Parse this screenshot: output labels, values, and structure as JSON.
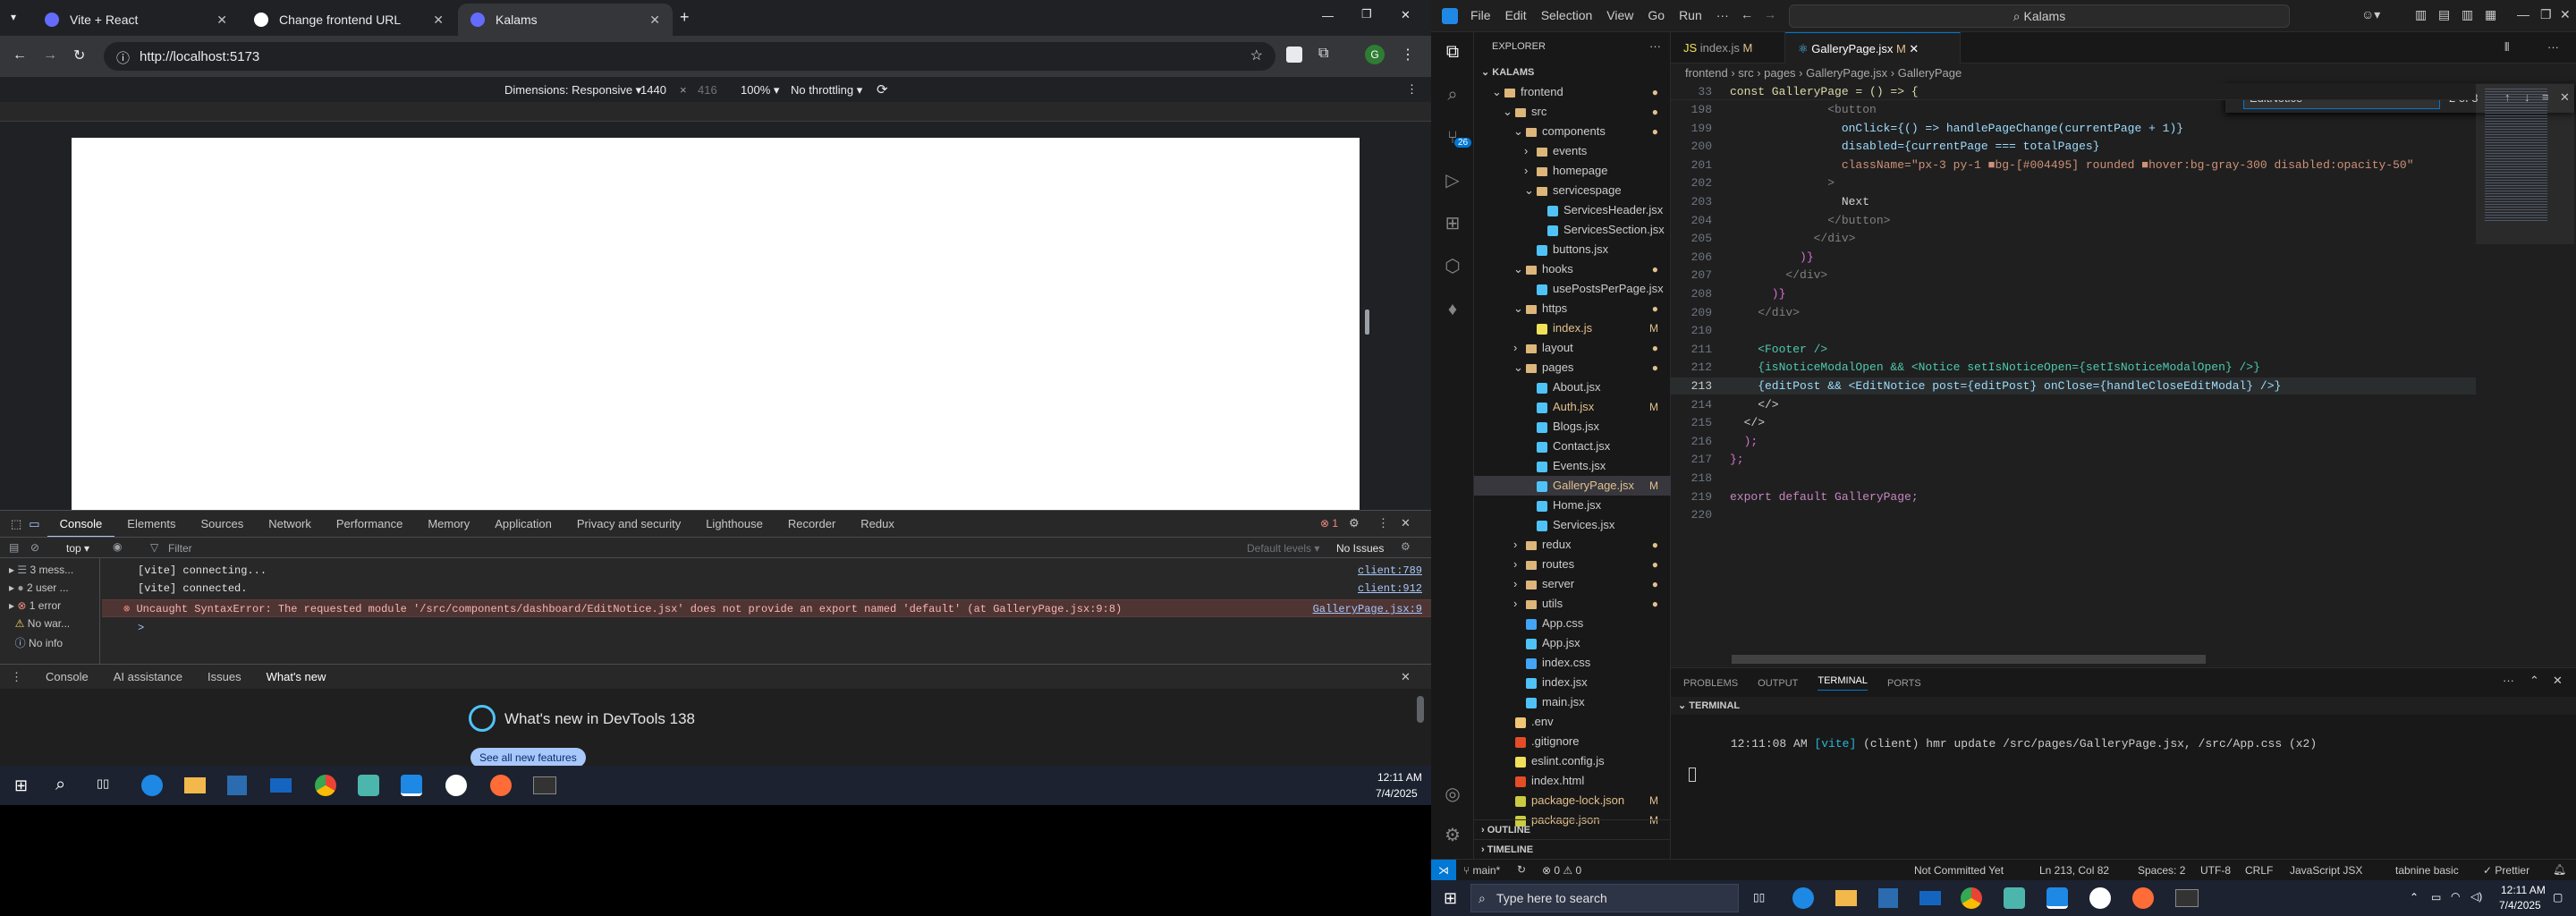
{
  "browser": {
    "tabs": [
      {
        "title": "Vite + React",
        "fav_color": "#646cff"
      },
      {
        "title": "Change frontend URL",
        "fav_color": "#ffffff"
      },
      {
        "title": "Kalams",
        "fav_color": "#646cff"
      }
    ],
    "url": "http://localhost:5173",
    "device_toolbar": {
      "dimensions": "Dimensions: Responsive ▾",
      "width": "1440",
      "times": "×",
      "height": "416",
      "zoom": "100% ▾",
      "throttle": "No throttling ▾"
    }
  },
  "devtools": {
    "tabs": [
      "Console",
      "Elements",
      "Sources",
      "Network",
      "Performance",
      "Memory",
      "Application",
      "Privacy and security",
      "Lighthouse",
      "Recorder",
      "Redux"
    ],
    "error_count": "1",
    "context": "top ▾",
    "filter_placeholder": "Filter",
    "levels": "Default levels ▾",
    "issues": "No Issues",
    "sidebar": [
      {
        "label": "3 mess..."
      },
      {
        "label": "2 user ..."
      },
      {
        "label": "1 error"
      },
      {
        "label": "No war..."
      },
      {
        "label": "No info"
      }
    ],
    "lines": [
      {
        "text": "[vite] connecting...",
        "link": "client:789"
      },
      {
        "text": "[vite] connected.",
        "link": "client:912"
      },
      {
        "text": "Uncaught SyntaxError: The requested module '/src/components/dashboard/EditNotice.jsx' does not provide an export named 'default' (at GalleryPage.jsx:9:8)",
        "link": "GalleryPage.jsx:9"
      }
    ],
    "prompt": ">",
    "drawer_tabs": [
      "Console",
      "AI assistance",
      "Issues",
      "What's new"
    ],
    "whats_new_title": "What's new in DevTools 138",
    "whats_new_button": "See all new features"
  },
  "left_taskbar": {
    "time": "12:11 AM",
    "date": "7/4/2025"
  },
  "vscode": {
    "menu": [
      "File",
      "Edit",
      "Selection",
      "View",
      "Go",
      "Run",
      "···"
    ],
    "search": "Kalams",
    "explorer_title": "EXPLORER",
    "root": "KALAMS",
    "tree": [
      {
        "label": "frontend",
        "indent": 1,
        "type": "folder",
        "mark": "",
        "open": true
      },
      {
        "label": "src",
        "indent": 2,
        "type": "folder",
        "mark": "",
        "open": true
      },
      {
        "label": "components",
        "indent": 3,
        "type": "folder",
        "mark": "",
        "open": true
      },
      {
        "label": "events",
        "indent": 4,
        "type": "folder",
        "mark": "",
        "open": false
      },
      {
        "label": "homepage",
        "indent": 4,
        "type": "folder",
        "mark": "",
        "open": false
      },
      {
        "label": "servicespage",
        "indent": 4,
        "type": "folder",
        "mark": "",
        "open": true
      },
      {
        "label": "ServicesHeader.jsx",
        "indent": 5,
        "type": "jsx",
        "mark": ""
      },
      {
        "label": "ServicesSection.jsx",
        "indent": 5,
        "type": "jsx",
        "mark": ""
      },
      {
        "label": "buttons.jsx",
        "indent": 4,
        "type": "jsx",
        "mark": ""
      },
      {
        "label": "hooks",
        "indent": 3,
        "type": "folder",
        "mark": "",
        "open": true
      },
      {
        "label": "usePostsPerPage.jsx",
        "indent": 4,
        "type": "jsx",
        "mark": ""
      },
      {
        "label": "https",
        "indent": 3,
        "type": "folder",
        "mark": "",
        "open": true
      },
      {
        "label": "index.js",
        "indent": 4,
        "type": "js",
        "mark": "M"
      },
      {
        "label": "layout",
        "indent": 3,
        "type": "folder",
        "mark": "",
        "open": false
      },
      {
        "label": "pages",
        "indent": 3,
        "type": "folder",
        "mark": "",
        "open": true
      },
      {
        "label": "About.jsx",
        "indent": 4,
        "type": "jsx",
        "mark": ""
      },
      {
        "label": "Auth.jsx",
        "indent": 4,
        "type": "jsx",
        "mark": "M"
      },
      {
        "label": "Blogs.jsx",
        "indent": 4,
        "type": "jsx",
        "mark": ""
      },
      {
        "label": "Contact.jsx",
        "indent": 4,
        "type": "jsx",
        "mark": ""
      },
      {
        "label": "Events.jsx",
        "indent": 4,
        "type": "jsx",
        "mark": ""
      },
      {
        "label": "GalleryPage.jsx",
        "indent": 4,
        "type": "jsx",
        "mark": "M",
        "selected": true
      },
      {
        "label": "Home.jsx",
        "indent": 4,
        "type": "jsx",
        "mark": ""
      },
      {
        "label": "Services.jsx",
        "indent": 4,
        "type": "jsx",
        "mark": ""
      },
      {
        "label": "redux",
        "indent": 3,
        "type": "folder",
        "mark": "",
        "open": false
      },
      {
        "label": "routes",
        "indent": 3,
        "type": "folder",
        "mark": "",
        "open": false
      },
      {
        "label": "server",
        "indent": 3,
        "type": "folder",
        "mark": "",
        "open": false
      },
      {
        "label": "utils",
        "indent": 3,
        "type": "folder",
        "mark": "",
        "open": false
      },
      {
        "label": "App.css",
        "indent": 3,
        "type": "css",
        "mark": ""
      },
      {
        "label": "App.jsx",
        "indent": 3,
        "type": "jsx",
        "mark": ""
      },
      {
        "label": "index.css",
        "indent": 3,
        "type": "css",
        "mark": ""
      },
      {
        "label": "index.jsx",
        "indent": 3,
        "type": "jsx",
        "mark": ""
      },
      {
        "label": "main.jsx",
        "indent": 3,
        "type": "jsx",
        "mark": ""
      },
      {
        "label": ".env",
        "indent": 2,
        "type": "env",
        "mark": ""
      },
      {
        "label": ".gitignore",
        "indent": 2,
        "type": "git",
        "mark": ""
      },
      {
        "label": "eslint.config.js",
        "indent": 2,
        "type": "js",
        "mark": ""
      },
      {
        "label": "index.html",
        "indent": 2,
        "type": "html",
        "mark": ""
      },
      {
        "label": "package-lock.json",
        "indent": 2,
        "type": "json",
        "mark": "M"
      },
      {
        "label": "package.json",
        "indent": 2,
        "type": "json",
        "mark": "M"
      }
    ],
    "outline": "OUTLINE",
    "timeline": "TIMELINE",
    "editor_tabs": [
      {
        "label": "index.js",
        "mark": "M"
      },
      {
        "label": "GalleryPage.jsx",
        "mark": "M"
      }
    ],
    "breadcrumb": "frontend  ›  src  ›  pages  ›  GalleryPage.jsx  ›  GalleryPage",
    "sticky": {
      "num": "33",
      "code": "const GalleryPage = () => {"
    },
    "find": {
      "value": "EditNotice",
      "count": "2 of 3"
    },
    "code": [
      {
        "num": "198",
        "code": "              <button"
      },
      {
        "num": "199",
        "code": "                onClick={() => handlePageChange(currentPage + 1)}"
      },
      {
        "num": "200",
        "code": "                disabled={currentPage === totalPages}"
      },
      {
        "num": "201",
        "code": "                className=\"px-3 py-1 ■bg-[#004495] rounded ■hover:bg-gray-300 disabled:opacity-50\""
      },
      {
        "num": "202",
        "code": "              >"
      },
      {
        "num": "203",
        "code": "                Next"
      },
      {
        "num": "204",
        "code": "              </button>"
      },
      {
        "num": "205",
        "code": "            </div>"
      },
      {
        "num": "206",
        "code": "          )}"
      },
      {
        "num": "207",
        "code": "        </div>"
      },
      {
        "num": "208",
        "code": "      )}"
      },
      {
        "num": "209",
        "code": "    </div>"
      },
      {
        "num": "210",
        "code": ""
      },
      {
        "num": "211",
        "code": "    <Footer />"
      },
      {
        "num": "212",
        "code": "    {isNoticeModalOpen && <Notice setIsNoticeOpen={setIsNoticeModalOpen} />}"
      },
      {
        "num": "213",
        "code": "    {editPost && <EditNotice post={editPost} onClose={handleCloseEditModal} />}"
      },
      {
        "num": "214",
        "code": "    </>"
      },
      {
        "num": "215",
        "code": "  </>"
      },
      {
        "num": "216",
        "code": "  );"
      },
      {
        "num": "217",
        "code": "};"
      },
      {
        "num": "218",
        "code": ""
      },
      {
        "num": "219",
        "code": "export default GalleryPage;"
      },
      {
        "num": "220",
        "code": ""
      }
    ],
    "panel_tabs": [
      "PROBLEMS",
      "OUTPUT",
      "TERMINAL",
      "PORTS"
    ],
    "terminal_label": "TERMINAL",
    "terminal_line": {
      "time": "12:11:08 AM",
      "tag": "[vite]",
      "text": "(client) hmr update /src/pages/GalleryPage.jsx, /src/App.css (x2)"
    },
    "status": {
      "branch": "main*",
      "problems": "⊗ 0 ⚠ 0",
      "not_committed": "Not Committed Yet",
      "position": "Ln 213, Col 82",
      "spaces": "Spaces: 2",
      "encoding": "UTF-8",
      "eol": "CRLF",
      "language": "JavaScript JSX",
      "tabnine": "tabnine basic",
      "prettier": "✓ Prettier"
    },
    "badge_count": "26"
  },
  "right_taskbar": {
    "search": "Type here to search",
    "time": "12:11 AM",
    "date": "7/4/2025"
  }
}
